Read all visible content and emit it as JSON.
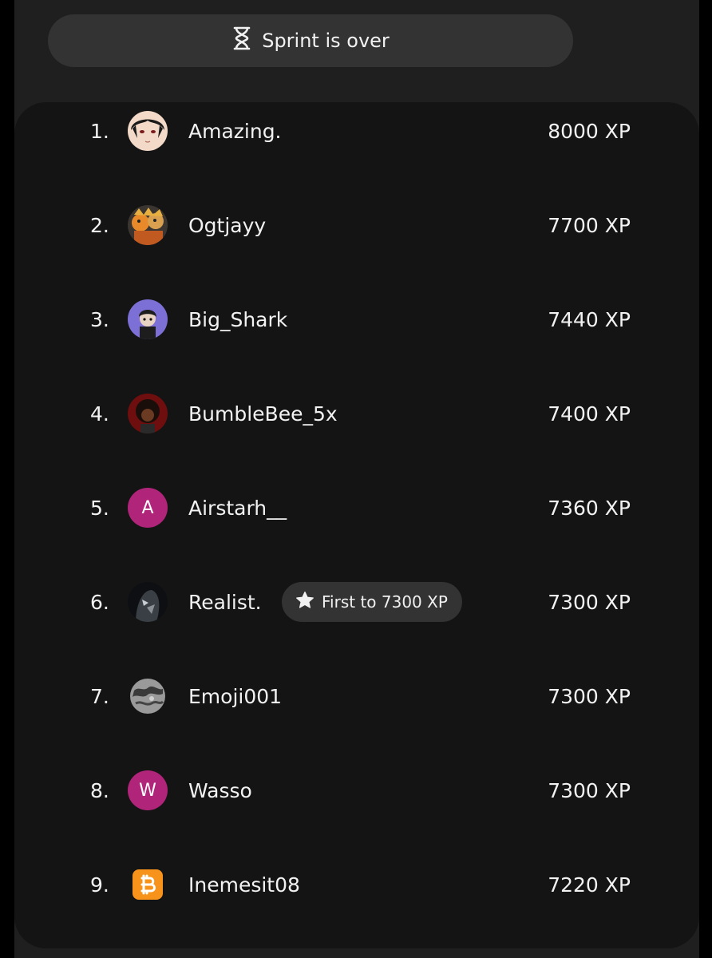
{
  "banner": {
    "label": "Sprint is over",
    "icon": "hourglass-icon"
  },
  "leaderboard": [
    {
      "rank": "1.",
      "name": "Amazing.",
      "xp": "8000 XP",
      "avatar": {
        "type": "image",
        "desc": "anime-face"
      }
    },
    {
      "rank": "2.",
      "name": "Ogtjayy",
      "xp": "7700 XP",
      "avatar": {
        "type": "image",
        "desc": "anime-characters"
      }
    },
    {
      "rank": "3.",
      "name": "Big_Shark",
      "xp": "7440 XP",
      "avatar": {
        "type": "image",
        "desc": "cartoon-boy-purple"
      }
    },
    {
      "rank": "4.",
      "name": "BumbleBee_5x",
      "xp": "7400 XP",
      "avatar": {
        "type": "image",
        "desc": "cartoon-afro-red"
      }
    },
    {
      "rank": "5.",
      "name": "Airstarh__",
      "xp": "7360 XP",
      "avatar": {
        "type": "letter",
        "letter": "A",
        "color": "#b0247a"
      }
    },
    {
      "rank": "6.",
      "name": "Realist.",
      "xp": "7300 XP",
      "avatar": {
        "type": "image",
        "desc": "dark-portrait"
      },
      "badge": {
        "label": "First to 7300 XP",
        "icon": "star-icon"
      }
    },
    {
      "rank": "7.",
      "name": "Emoji001",
      "xp": "7300 XP",
      "avatar": {
        "type": "image",
        "desc": "grey-globe"
      }
    },
    {
      "rank": "8.",
      "name": "Wasso",
      "xp": "7300 XP",
      "avatar": {
        "type": "letter",
        "letter": "W",
        "color": "#b0247a"
      }
    },
    {
      "rank": "9.",
      "name": "Inemesit08",
      "xp": "7220 XP",
      "avatar": {
        "type": "image",
        "desc": "bitcoin-logo"
      }
    }
  ],
  "colors": {
    "background": "#1f1f1f",
    "board": "#141414",
    "pill": "#333333",
    "text": "#f2f2f2",
    "letter_avatar": "#b0247a",
    "bitcoin": "#f7931a"
  }
}
